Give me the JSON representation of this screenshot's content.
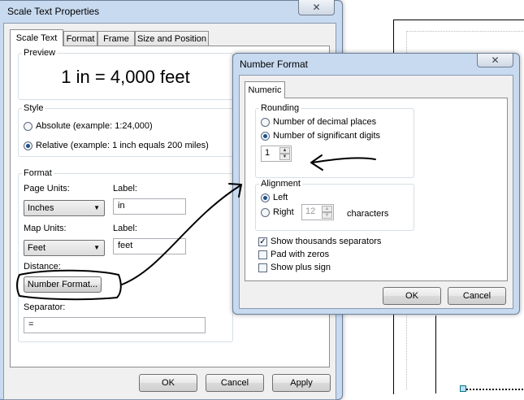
{
  "scale_dialog": {
    "title": "Scale Text Properties",
    "tabs": [
      "Scale Text",
      "Format",
      "Frame",
      "Size and Position"
    ],
    "preview_label": "Preview",
    "preview_text": "1 in = 4,000 feet",
    "style_label": "Style",
    "absolute_label": "Absolute (example: 1:24,000)",
    "relative_label": "Relative  (example: 1 inch equals 200 miles)",
    "format_label": "Format",
    "page_units_label": "Page Units:",
    "page_units_value": "Inches",
    "label1": "Label:",
    "label1_value": "in",
    "map_units_label": "Map Units:",
    "map_units_value": "Feet",
    "label2": "Label:",
    "label2_value": "feet",
    "distance_label": "Distance:",
    "number_format_button": "Number Format...",
    "separator_label": "Separator:",
    "separator_value": "=",
    "ok": "OK",
    "cancel": "Cancel",
    "apply": "Apply"
  },
  "number_dialog": {
    "title": "Number Format",
    "tab": "Numeric",
    "rounding_label": "Rounding",
    "decimal_places": "Number of decimal places",
    "significant_digits": "Number of significant digits",
    "rounding_value": "1",
    "alignment_label": "Alignment",
    "left": "Left",
    "right": "Right",
    "characters_value": "12",
    "characters_label": "characters",
    "show_thousands": "Show thousands separators",
    "pad_zeros": "Pad with zeros",
    "show_plus": "Show plus sign",
    "ok": "OK",
    "cancel": "Cancel"
  },
  "icons": {
    "close": "✕",
    "dropdown": "▼",
    "spin_up": "▲",
    "spin_down": "▼",
    "check": "✓"
  }
}
